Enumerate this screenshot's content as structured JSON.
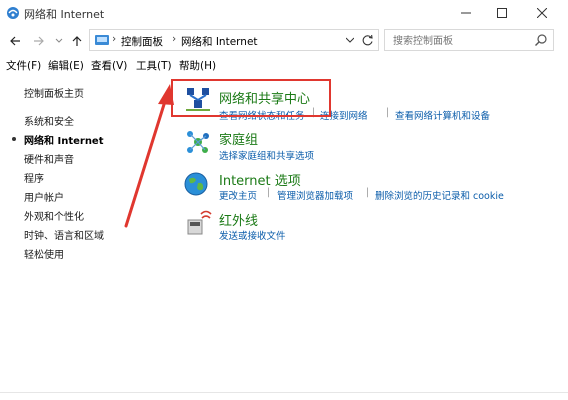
{
  "window": {
    "title": "网络和 Internet",
    "controls": [
      "minimize",
      "maximize",
      "close"
    ]
  },
  "nav": {
    "breadcrumbs": [
      "控制面板",
      "网络和 Internet"
    ],
    "search_placeholder": "搜索控制面板"
  },
  "menu": [
    "文件(F)",
    "编辑(E)",
    "查看(V)",
    "工具(T)",
    "帮助(H)"
  ],
  "sidebar": {
    "items": [
      {
        "label": "控制面板主页",
        "active": false
      },
      {
        "label": "系统和安全",
        "active": false
      },
      {
        "label": "网络和 Internet",
        "active": true
      },
      {
        "label": "硬件和声音",
        "active": false
      },
      {
        "label": "程序",
        "active": false
      },
      {
        "label": "用户帐户",
        "active": false
      },
      {
        "label": "外观和个性化",
        "active": false
      },
      {
        "label": "时钟、语言和区域",
        "active": false
      },
      {
        "label": "轻松使用",
        "active": false
      }
    ]
  },
  "categories": [
    {
      "title": "网络和共享中心",
      "icon": "network-sharing-center-icon",
      "links": [
        "查看网络状态和任务",
        "连接到网络",
        "查看网络计算机和设备"
      ]
    },
    {
      "title": "家庭组",
      "icon": "homegroup-icon",
      "links": [
        "选择家庭组和共享选项"
      ]
    },
    {
      "title": "Internet 选项",
      "icon": "internet-options-icon",
      "links": [
        "更改主页",
        "管理浏览器加载项",
        "删除浏览的历史记录和 cookie"
      ]
    },
    {
      "title": "红外线",
      "icon": "infrared-icon",
      "links": [
        "发送或接收文件"
      ]
    }
  ],
  "colors": {
    "category_title": "#1b7a16",
    "link": "#0a5caa",
    "highlight": "#e0372f"
  }
}
